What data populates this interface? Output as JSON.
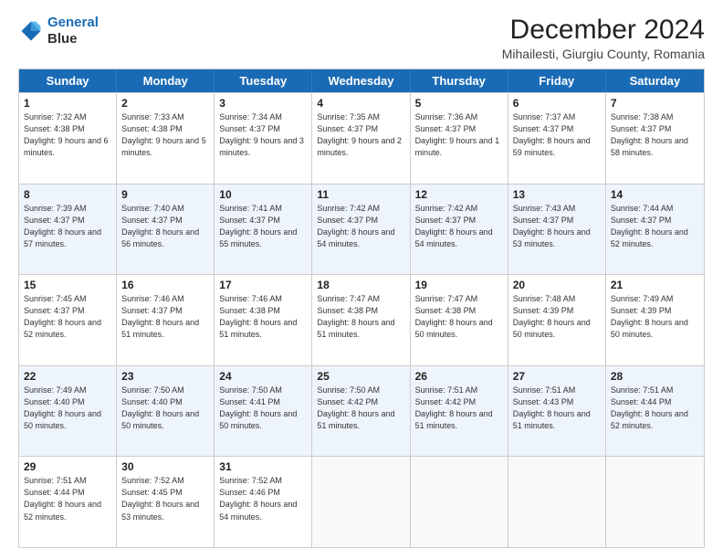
{
  "logo": {
    "line1": "General",
    "line2": "Blue"
  },
  "title": "December 2024",
  "subtitle": "Mihailesti, Giurgiu County, Romania",
  "header_days": [
    "Sunday",
    "Monday",
    "Tuesday",
    "Wednesday",
    "Thursday",
    "Friday",
    "Saturday"
  ],
  "weeks": [
    {
      "alt": false,
      "days": [
        {
          "num": "1",
          "sunrise": "Sunrise: 7:32 AM",
          "sunset": "Sunset: 4:38 PM",
          "daylight": "Daylight: 9 hours and 6 minutes."
        },
        {
          "num": "2",
          "sunrise": "Sunrise: 7:33 AM",
          "sunset": "Sunset: 4:38 PM",
          "daylight": "Daylight: 9 hours and 5 minutes."
        },
        {
          "num": "3",
          "sunrise": "Sunrise: 7:34 AM",
          "sunset": "Sunset: 4:37 PM",
          "daylight": "Daylight: 9 hours and 3 minutes."
        },
        {
          "num": "4",
          "sunrise": "Sunrise: 7:35 AM",
          "sunset": "Sunset: 4:37 PM",
          "daylight": "Daylight: 9 hours and 2 minutes."
        },
        {
          "num": "5",
          "sunrise": "Sunrise: 7:36 AM",
          "sunset": "Sunset: 4:37 PM",
          "daylight": "Daylight: 9 hours and 1 minute."
        },
        {
          "num": "6",
          "sunrise": "Sunrise: 7:37 AM",
          "sunset": "Sunset: 4:37 PM",
          "daylight": "Daylight: 8 hours and 59 minutes."
        },
        {
          "num": "7",
          "sunrise": "Sunrise: 7:38 AM",
          "sunset": "Sunset: 4:37 PM",
          "daylight": "Daylight: 8 hours and 58 minutes."
        }
      ]
    },
    {
      "alt": true,
      "days": [
        {
          "num": "8",
          "sunrise": "Sunrise: 7:39 AM",
          "sunset": "Sunset: 4:37 PM",
          "daylight": "Daylight: 8 hours and 57 minutes."
        },
        {
          "num": "9",
          "sunrise": "Sunrise: 7:40 AM",
          "sunset": "Sunset: 4:37 PM",
          "daylight": "Daylight: 8 hours and 56 minutes."
        },
        {
          "num": "10",
          "sunrise": "Sunrise: 7:41 AM",
          "sunset": "Sunset: 4:37 PM",
          "daylight": "Daylight: 8 hours and 55 minutes."
        },
        {
          "num": "11",
          "sunrise": "Sunrise: 7:42 AM",
          "sunset": "Sunset: 4:37 PM",
          "daylight": "Daylight: 8 hours and 54 minutes."
        },
        {
          "num": "12",
          "sunrise": "Sunrise: 7:42 AM",
          "sunset": "Sunset: 4:37 PM",
          "daylight": "Daylight: 8 hours and 54 minutes."
        },
        {
          "num": "13",
          "sunrise": "Sunrise: 7:43 AM",
          "sunset": "Sunset: 4:37 PM",
          "daylight": "Daylight: 8 hours and 53 minutes."
        },
        {
          "num": "14",
          "sunrise": "Sunrise: 7:44 AM",
          "sunset": "Sunset: 4:37 PM",
          "daylight": "Daylight: 8 hours and 52 minutes."
        }
      ]
    },
    {
      "alt": false,
      "days": [
        {
          "num": "15",
          "sunrise": "Sunrise: 7:45 AM",
          "sunset": "Sunset: 4:37 PM",
          "daylight": "Daylight: 8 hours and 52 minutes."
        },
        {
          "num": "16",
          "sunrise": "Sunrise: 7:46 AM",
          "sunset": "Sunset: 4:37 PM",
          "daylight": "Daylight: 8 hours and 51 minutes."
        },
        {
          "num": "17",
          "sunrise": "Sunrise: 7:46 AM",
          "sunset": "Sunset: 4:38 PM",
          "daylight": "Daylight: 8 hours and 51 minutes."
        },
        {
          "num": "18",
          "sunrise": "Sunrise: 7:47 AM",
          "sunset": "Sunset: 4:38 PM",
          "daylight": "Daylight: 8 hours and 51 minutes."
        },
        {
          "num": "19",
          "sunrise": "Sunrise: 7:47 AM",
          "sunset": "Sunset: 4:38 PM",
          "daylight": "Daylight: 8 hours and 50 minutes."
        },
        {
          "num": "20",
          "sunrise": "Sunrise: 7:48 AM",
          "sunset": "Sunset: 4:39 PM",
          "daylight": "Daylight: 8 hours and 50 minutes."
        },
        {
          "num": "21",
          "sunrise": "Sunrise: 7:49 AM",
          "sunset": "Sunset: 4:39 PM",
          "daylight": "Daylight: 8 hours and 50 minutes."
        }
      ]
    },
    {
      "alt": true,
      "days": [
        {
          "num": "22",
          "sunrise": "Sunrise: 7:49 AM",
          "sunset": "Sunset: 4:40 PM",
          "daylight": "Daylight: 8 hours and 50 minutes."
        },
        {
          "num": "23",
          "sunrise": "Sunrise: 7:50 AM",
          "sunset": "Sunset: 4:40 PM",
          "daylight": "Daylight: 8 hours and 50 minutes."
        },
        {
          "num": "24",
          "sunrise": "Sunrise: 7:50 AM",
          "sunset": "Sunset: 4:41 PM",
          "daylight": "Daylight: 8 hours and 50 minutes."
        },
        {
          "num": "25",
          "sunrise": "Sunrise: 7:50 AM",
          "sunset": "Sunset: 4:42 PM",
          "daylight": "Daylight: 8 hours and 51 minutes."
        },
        {
          "num": "26",
          "sunrise": "Sunrise: 7:51 AM",
          "sunset": "Sunset: 4:42 PM",
          "daylight": "Daylight: 8 hours and 51 minutes."
        },
        {
          "num": "27",
          "sunrise": "Sunrise: 7:51 AM",
          "sunset": "Sunset: 4:43 PM",
          "daylight": "Daylight: 8 hours and 51 minutes."
        },
        {
          "num": "28",
          "sunrise": "Sunrise: 7:51 AM",
          "sunset": "Sunset: 4:44 PM",
          "daylight": "Daylight: 8 hours and 52 minutes."
        }
      ]
    },
    {
      "alt": false,
      "days": [
        {
          "num": "29",
          "sunrise": "Sunrise: 7:51 AM",
          "sunset": "Sunset: 4:44 PM",
          "daylight": "Daylight: 8 hours and 52 minutes."
        },
        {
          "num": "30",
          "sunrise": "Sunrise: 7:52 AM",
          "sunset": "Sunset: 4:45 PM",
          "daylight": "Daylight: 8 hours and 53 minutes."
        },
        {
          "num": "31",
          "sunrise": "Sunrise: 7:52 AM",
          "sunset": "Sunset: 4:46 PM",
          "daylight": "Daylight: 8 hours and 54 minutes."
        },
        null,
        null,
        null,
        null
      ]
    }
  ]
}
